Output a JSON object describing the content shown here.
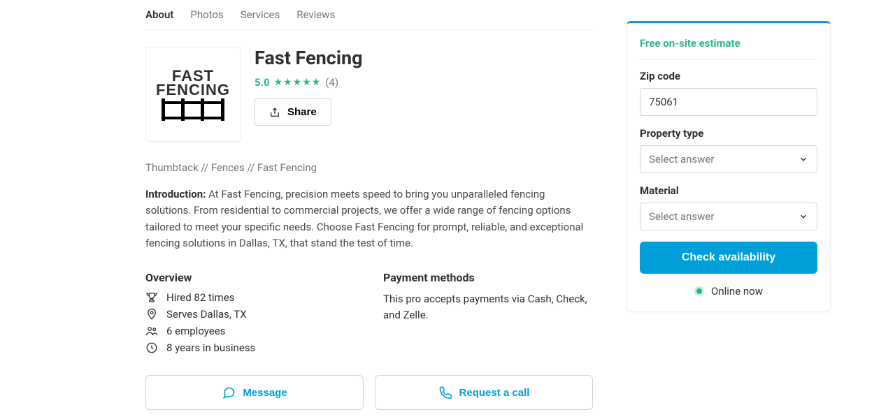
{
  "tabs": [
    "About",
    "Photos",
    "Services",
    "Reviews"
  ],
  "business": {
    "name": "Fast Fencing",
    "rating": "5.0",
    "reviewCount": "(4)",
    "shareLabel": "Share"
  },
  "breadcrumb": {
    "a": "Thumbtack",
    "sep": " // ",
    "b": "Fences",
    "c": "Fast Fencing"
  },
  "intro": {
    "label": "Introduction:",
    "body": " At Fast Fencing, precision meets speed to bring you unparalleled fencing solutions. From residential to commercial projects, we offer a wide range of fencing options tailored to meet your specific needs. Choose Fast Fencing for prompt, reliable, and exceptional fencing solutions in Dallas, TX, that stand the test of time."
  },
  "overview": {
    "title": "Overview",
    "hired": "Hired 82 times",
    "serves": "Serves Dallas, TX",
    "employees": "6 employees",
    "years": "8 years in business"
  },
  "payment": {
    "title": "Payment methods",
    "body": "This pro accepts payments via Cash, Check, and Zelle."
  },
  "actions": {
    "message": "Message",
    "request": "Request a call"
  },
  "sidebar": {
    "estimate": "Free on-site estimate",
    "zipLabel": "Zip code",
    "zipValue": "75061",
    "propertyLabel": "Property type",
    "selectPlaceholder": "Select answer",
    "materialLabel": "Material",
    "checkLabel": "Check availability",
    "onlineLabel": "Online now"
  }
}
